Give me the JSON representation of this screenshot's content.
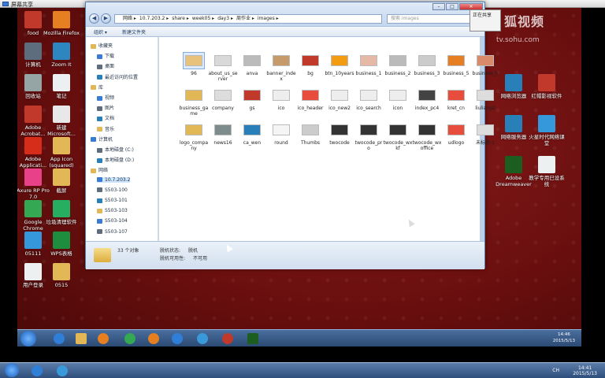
{
  "session": {
    "title": "屏幕共享"
  },
  "desktop_icons_left": [
    {
      "label": "food",
      "color": "#c0392b"
    },
    {
      "label": "Mozilla Firefox",
      "color": "#e67e22"
    },
    {
      "label": "计算机",
      "color": "#5d6d7e"
    },
    {
      "label": "Zoom It",
      "color": "#2e86c1"
    },
    {
      "label": "回收站",
      "color": "#95a5a6"
    },
    {
      "label": "笔记",
      "color": "#ecf0f1"
    },
    {
      "label": "Adobe Acrobat...",
      "color": "#c0392b"
    },
    {
      "label": "新建 Microsoft...",
      "color": "#e8e8e8"
    },
    {
      "label": "Adobe Applicati...",
      "color": "#d62c1a"
    },
    {
      "label": "App Icon (squared)",
      "color": "#e2b857"
    },
    {
      "label": "Axure RP Pro 7.0",
      "color": "#e8418a"
    },
    {
      "label": "截屏",
      "color": "#e2b857"
    },
    {
      "label": "Google Chrome",
      "color": "#34a853"
    },
    {
      "label": "垃圾清理软件",
      "color": "#27ae60"
    },
    {
      "label": "05111",
      "color": "#3498db"
    },
    {
      "label": "WPS表格",
      "color": "#1e8e3e"
    },
    {
      "label": "用户登录",
      "color": "#ecf0f1"
    },
    {
      "label": "0515",
      "color": "#e2b857"
    }
  ],
  "desktop_icons_right": [
    {
      "label": "网络浏览器",
      "color": "#2980b9"
    },
    {
      "label": "红帽影视软件",
      "color": "#c0392b"
    },
    {
      "label": "网络服务器",
      "color": "#2980b9"
    },
    {
      "label": "火星时代网络课堂",
      "color": "#3498db"
    },
    {
      "label": "Adobe Dreamweaver",
      "color": "#1b5e20"
    },
    {
      "label": "教学专用已设系统",
      "color": "#ecf0f1"
    }
  ],
  "watermark": {
    "brand": "狐视频",
    "url": "tv.sohu.com"
  },
  "popup": {
    "title": "正在共享"
  },
  "explorer": {
    "address": [
      "网络",
      "10.7.203.2",
      "share",
      "week05",
      "day3",
      "周作业",
      "images"
    ],
    "search_placeholder": "搜索 images",
    "toolbar": {
      "organize": "组织 ▾",
      "new_folder": "新建文件夹"
    },
    "sidebar": [
      {
        "label": "收藏夹",
        "indent": 0
      },
      {
        "label": "下载",
        "indent": 1
      },
      {
        "label": "桌面",
        "indent": 1
      },
      {
        "label": "最近访问的位置",
        "indent": 1
      },
      {
        "label": "库",
        "indent": 0
      },
      {
        "label": "视频",
        "indent": 1
      },
      {
        "label": "图片",
        "indent": 1
      },
      {
        "label": "文档",
        "indent": 1
      },
      {
        "label": "音乐",
        "indent": 1
      },
      {
        "label": "计算机",
        "indent": 0
      },
      {
        "label": "本地磁盘 (C:)",
        "indent": 1
      },
      {
        "label": "本地磁盘 (D:)",
        "indent": 1
      },
      {
        "label": "网络",
        "indent": 0
      },
      {
        "label": "10.7.203.2",
        "indent": 1,
        "selected": true
      },
      {
        "label": "S503-100",
        "indent": 1
      },
      {
        "label": "S503-101",
        "indent": 1
      },
      {
        "label": "S503-103",
        "indent": 1
      },
      {
        "label": "S503-104",
        "indent": 1
      },
      {
        "label": "S503-107",
        "indent": 1
      }
    ],
    "files": [
      {
        "name": "96",
        "color": "#e8c27a",
        "selected": true
      },
      {
        "name": "about_us_server",
        "color": "#d9d9d9"
      },
      {
        "name": "anva",
        "color": "#bbbbbb"
      },
      {
        "name": "banner_index",
        "color": "#c79a6a"
      },
      {
        "name": "bg",
        "color": "#c0392b"
      },
      {
        "name": "btn_10years",
        "color": "#f39c12"
      },
      {
        "name": "business_1",
        "color": "#e6b9a6"
      },
      {
        "name": "business_2",
        "color": "#bbbbbb"
      },
      {
        "name": "business_3",
        "color": "#cccccc"
      },
      {
        "name": "business_5",
        "color": "#e67e22"
      },
      {
        "name": "business_6",
        "color": "#d98a6a"
      },
      {
        "name": "business_game",
        "color": "#e2b857"
      },
      {
        "name": "company",
        "color": "#dddddd"
      },
      {
        "name": "gs",
        "color": "#c0392b"
      },
      {
        "name": "ico",
        "color": "#eeeeee"
      },
      {
        "name": "ico_header",
        "color": "#e74c3c"
      },
      {
        "name": "ico_new2",
        "color": "#eeeeee"
      },
      {
        "name": "ico_search",
        "color": "#eeeeee"
      },
      {
        "name": "icon",
        "color": "#eeeeee"
      },
      {
        "name": "index_pc4",
        "color": "#444444"
      },
      {
        "name": "kret_cn",
        "color": "#e74c3c"
      },
      {
        "name": "liuliang2",
        "color": "#dddddd"
      },
      {
        "name": "logo_company",
        "color": "#e2b857"
      },
      {
        "name": "news16",
        "color": "#7f8c8d"
      },
      {
        "name": "ca_wen",
        "color": "#2980b9"
      },
      {
        "name": "round",
        "color": "#f5f5f5"
      },
      {
        "name": "Thumbs",
        "color": "#cccccc"
      },
      {
        "name": "twocode",
        "color": "#333333"
      },
      {
        "name": "twocode_pro",
        "color": "#333333"
      },
      {
        "name": "twocode_wxkf",
        "color": "#333333"
      },
      {
        "name": "twocode_wxoffice",
        "color": "#333333"
      },
      {
        "name": "udlogo",
        "color": "#e74c3c"
      },
      {
        "name": "未标题-1",
        "color": "#dddddd"
      }
    ],
    "status": {
      "count": "33 个对象",
      "state_label": "脱机状态:",
      "state_value": "脱机",
      "avail_label": "脱机可用性:",
      "avail_value": "不可用"
    }
  },
  "inner_clock": {
    "time": "14:46",
    "date": "2015/5/13"
  },
  "outer_clock": {
    "time": "14:41",
    "date": "2015/5/13"
  },
  "outer_ime": "CH"
}
